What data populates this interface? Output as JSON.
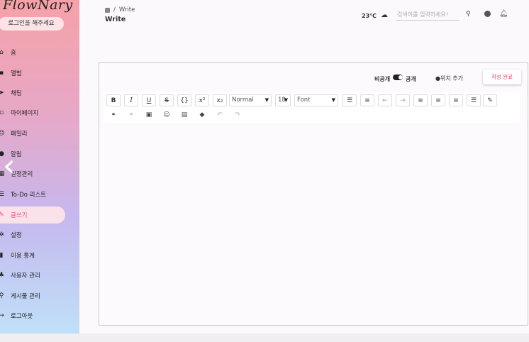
{
  "app": {
    "logo": "FlowNary"
  },
  "sidebar": {
    "login_button": "로그인을 해주세요",
    "items": [
      {
        "label": "홈",
        "icon": "home-icon"
      },
      {
        "label": "앨범",
        "icon": "album-icon"
      },
      {
        "label": "채팅",
        "icon": "chat-icon"
      },
      {
        "label": "마이페이지",
        "icon": "mypage-icon"
      },
      {
        "label": "패밀리",
        "icon": "family-icon"
      },
      {
        "label": "알림",
        "icon": "bell-icon"
      },
      {
        "label": "일정관리",
        "icon": "calendar-icon"
      },
      {
        "label": "To-Do 리스트",
        "icon": "list-icon"
      },
      {
        "label": "글쓰기",
        "icon": "write-icon",
        "active": true
      },
      {
        "label": "설정",
        "icon": "gear-icon"
      },
      {
        "label": "이용 통계",
        "icon": "stats-icon"
      },
      {
        "label": "사용자 관리",
        "icon": "users-icon"
      },
      {
        "label": "게시물 관리",
        "icon": "search-icon"
      },
      {
        "label": "로그아웃",
        "icon": "logout-icon"
      }
    ]
  },
  "header": {
    "breadcrumb": "Write",
    "title": "Write",
    "temperature": "23℃",
    "search_placeholder": "검색어를 입력하세요!"
  },
  "editor": {
    "private_label": "비공개",
    "public_label": "공개",
    "location_button": "위치 추가",
    "submit_button": "작성 완료",
    "format_select": "Normal",
    "size_select": "18",
    "font_select": "Font",
    "toolbar": {
      "bold": "B",
      "italic": "I",
      "underline": "U",
      "strike": "S",
      "code": "{}",
      "superscript": "x²",
      "subscript": "x₂"
    }
  },
  "colors": {
    "accent": "#e24b7e",
    "submit_text": "#e04b6d"
  }
}
